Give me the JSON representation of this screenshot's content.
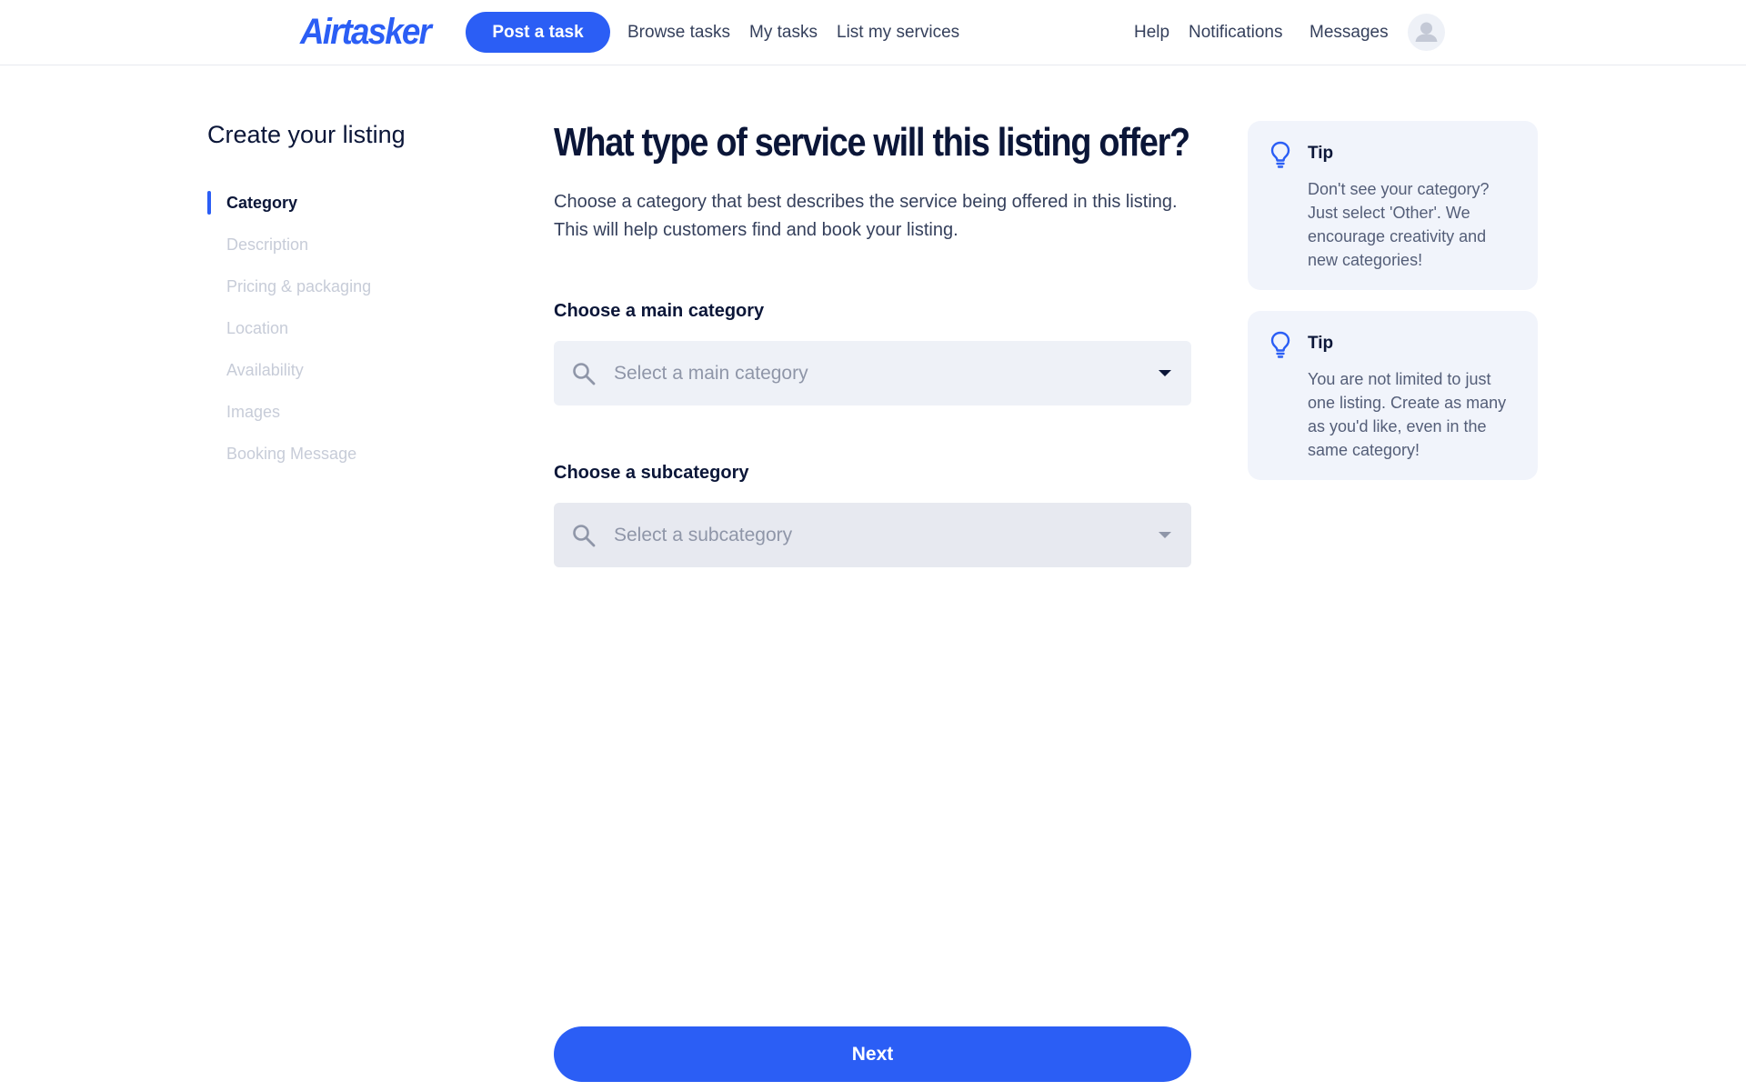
{
  "header": {
    "logo": "Airtasker",
    "post_task": "Post a task",
    "nav_left": [
      "Browse tasks",
      "My tasks",
      "List my services"
    ],
    "nav_right": [
      "Help",
      "Notifications",
      "Messages"
    ]
  },
  "sidebar": {
    "title": "Create your listing",
    "steps": [
      {
        "label": "Category",
        "active": true
      },
      {
        "label": "Description",
        "active": false
      },
      {
        "label": "Pricing & packaging",
        "active": false
      },
      {
        "label": "Location",
        "active": false
      },
      {
        "label": "Availability",
        "active": false
      },
      {
        "label": "Images",
        "active": false
      },
      {
        "label": "Booking Message",
        "active": false
      }
    ]
  },
  "main": {
    "title": "What type of service will this listing offer?",
    "description": "Choose a category that best describes the service being offered in this listing. This will help customers find and book your listing.",
    "main_category": {
      "label": "Choose a main category",
      "placeholder": "Select a main category"
    },
    "subcategory": {
      "label": "Choose a subcategory",
      "placeholder": "Select a subcategory"
    },
    "next": "Next"
  },
  "tips": [
    {
      "title": "Tip",
      "body": "Don't see your category? Just select 'Other'. We encourage creativity and new categories!"
    },
    {
      "title": "Tip",
      "body": "You are not limited to just one listing. Create as many as you'd like, even in the same category!"
    }
  ],
  "colors": {
    "brand_blue": "#2b5ef5",
    "navy_text": "#0b1638",
    "muted_step": "#c7ccd8",
    "tip_bg": "#f1f4fb",
    "select_bg": "#eef1f7"
  }
}
